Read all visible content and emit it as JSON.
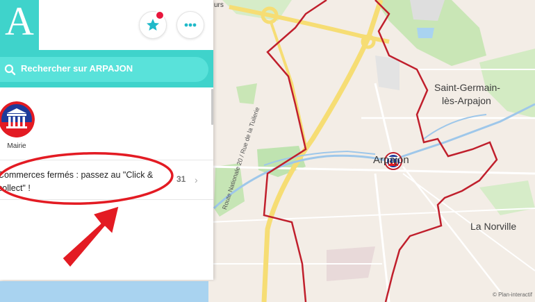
{
  "header": {
    "logo_letter": "A"
  },
  "search": {
    "placeholder": "Rechercher sur ARPAJON"
  },
  "shortcuts": [
    {
      "label": "Mairie"
    }
  ],
  "list_items": [
    {
      "text": "Commerces fermés : passez au \"Click & collect\" !",
      "count": "31"
    }
  ],
  "map": {
    "labels": {
      "saint_germain_line1": "Saint-Germain-",
      "saint_germain_line2": "lès-Arpajon",
      "arpajon": "Arpajon",
      "la_norville": "La Norville",
      "route": "Route Nationale 20 / Rue de la Tuilerie",
      "top_fragment": "urs"
    },
    "attribution": "© Plan-interactif"
  },
  "colors": {
    "accent": "#3fd3cb",
    "badge": "#e8163c",
    "annotation_red": "#e31b23",
    "commune_border": "#c01f2c"
  }
}
